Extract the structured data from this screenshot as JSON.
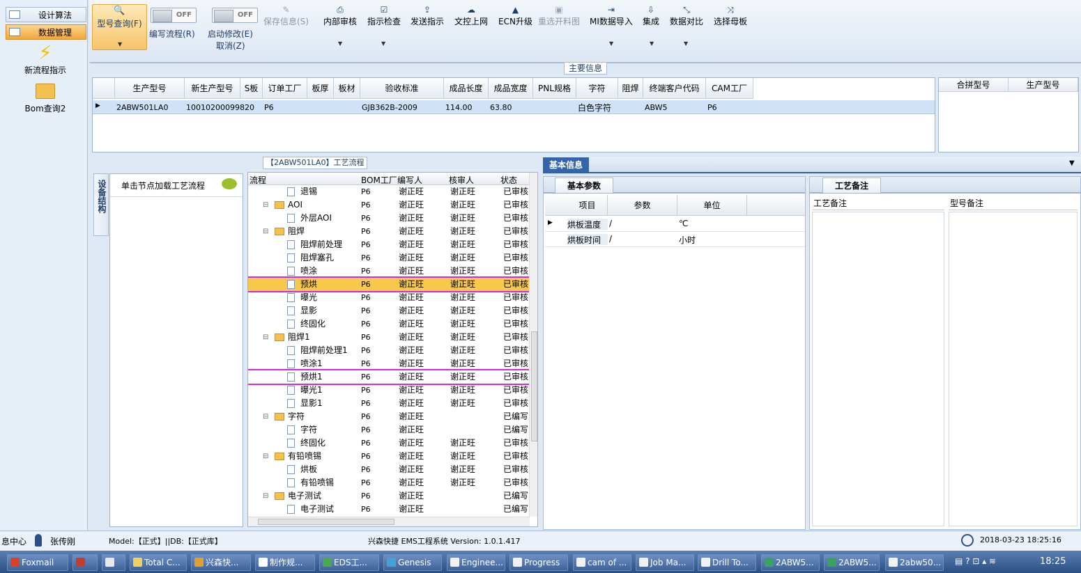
{
  "sidebar": {
    "items": [
      "设计算法",
      "数据管理"
    ],
    "big": [
      "新流程指示",
      "Bom查询2"
    ]
  },
  "ribbon": {
    "query": "型号查询(F)",
    "write_flow": "编写流程(R)",
    "start_edit": "启动修改(E)",
    "cancel": "取消(Z)",
    "toggle_off": "OFF",
    "buttons": [
      "保存信息(S)",
      "内部审核",
      "指示检查",
      "发送指示",
      "文控上网",
      "ECN升级",
      "重选开料图",
      "MI数据导入",
      "集成",
      "数据对比",
      "选择母板"
    ]
  },
  "main_info": {
    "title": "主要信息",
    "columns": [
      "生产型号",
      "新生产型号",
      "S板",
      "订单工厂",
      "板厚",
      "板材",
      "验收标准",
      "成品长度",
      "成品宽度",
      "PNL规格",
      "字符",
      "阻焊",
      "终端客户代码",
      "CAM工厂"
    ],
    "row": [
      "2ABW501LA0",
      "10010200099820",
      "",
      "P6",
      "",
      "",
      "GJB362B-2009",
      "114.00",
      "63.80",
      "",
      "白色字符",
      "",
      "ABW5",
      "P6"
    ],
    "side_columns": [
      "合拼型号",
      "生产型号"
    ]
  },
  "process": {
    "title": "【2ABW501LA0】工艺流程",
    "side_tab": "设备结构",
    "load_hint": "单击节点加载工艺流程",
    "columns": [
      "流程",
      "BOM工厂",
      "编写人",
      "核审人",
      "状态"
    ],
    "rows": [
      {
        "name": "退锡",
        "type": "file",
        "level": 2,
        "bom": "P6",
        "writer": "谢正旺",
        "checker": "谢正旺",
        "status": "已审核"
      },
      {
        "name": "AOI",
        "type": "folder",
        "level": 1,
        "bom": "P6",
        "writer": "谢正旺",
        "checker": "谢正旺",
        "status": "已审核"
      },
      {
        "name": "外层AOI",
        "type": "file",
        "level": 2,
        "bom": "P6",
        "writer": "谢正旺",
        "checker": "谢正旺",
        "status": "已审核"
      },
      {
        "name": "阻焊",
        "type": "folder",
        "level": 1,
        "bom": "P6",
        "writer": "谢正旺",
        "checker": "谢正旺",
        "status": "已审核"
      },
      {
        "name": "阻焊前处理",
        "type": "file",
        "level": 2,
        "bom": "P6",
        "writer": "谢正旺",
        "checker": "谢正旺",
        "status": "已审核"
      },
      {
        "name": "阻焊塞孔",
        "type": "file",
        "level": 2,
        "bom": "P6",
        "writer": "谢正旺",
        "checker": "谢正旺",
        "status": "已审核"
      },
      {
        "name": "喷涂",
        "type": "file",
        "level": 2,
        "bom": "P6",
        "writer": "谢正旺",
        "checker": "谢正旺",
        "status": "已审核"
      },
      {
        "name": "预烘",
        "type": "file",
        "level": 2,
        "bom": "P6",
        "writer": "谢正旺",
        "checker": "谢正旺",
        "status": "已审核",
        "selected": true
      },
      {
        "name": "曝光",
        "type": "file",
        "level": 2,
        "bom": "P6",
        "writer": "谢正旺",
        "checker": "谢正旺",
        "status": "已审核"
      },
      {
        "name": "显影",
        "type": "file",
        "level": 2,
        "bom": "P6",
        "writer": "谢正旺",
        "checker": "谢正旺",
        "status": "已审核"
      },
      {
        "name": "终固化",
        "type": "file",
        "level": 2,
        "bom": "P6",
        "writer": "谢正旺",
        "checker": "谢正旺",
        "status": "已审核"
      },
      {
        "name": "阻焊1",
        "type": "folder",
        "level": 1,
        "bom": "P6",
        "writer": "谢正旺",
        "checker": "谢正旺",
        "status": "已审核"
      },
      {
        "name": "阻焊前处理1",
        "type": "file",
        "level": 2,
        "bom": "P6",
        "writer": "谢正旺",
        "checker": "谢正旺",
        "status": "已审核"
      },
      {
        "name": "喷涂1",
        "type": "file",
        "level": 2,
        "bom": "P6",
        "writer": "谢正旺",
        "checker": "谢正旺",
        "status": "已审核"
      },
      {
        "name": "预烘1",
        "type": "file",
        "level": 2,
        "bom": "P6",
        "writer": "谢正旺",
        "checker": "谢正旺",
        "status": "已审核",
        "outlined": true
      },
      {
        "name": "曝光1",
        "type": "file",
        "level": 2,
        "bom": "P6",
        "writer": "谢正旺",
        "checker": "谢正旺",
        "status": "已审核"
      },
      {
        "name": "显影1",
        "type": "file",
        "level": 2,
        "bom": "P6",
        "writer": "谢正旺",
        "checker": "谢正旺",
        "status": "已审核"
      },
      {
        "name": "字符",
        "type": "folder",
        "level": 1,
        "bom": "P6",
        "writer": "谢正旺",
        "checker": "",
        "status": "已编写"
      },
      {
        "name": "字符",
        "type": "file",
        "level": 2,
        "bom": "P6",
        "writer": "谢正旺",
        "checker": "",
        "status": "已编写"
      },
      {
        "name": "终固化",
        "type": "file",
        "level": 2,
        "bom": "P6",
        "writer": "谢正旺",
        "checker": "谢正旺",
        "status": "已审核"
      },
      {
        "name": "有铅喷锡",
        "type": "folder",
        "level": 1,
        "bom": "P6",
        "writer": "谢正旺",
        "checker": "谢正旺",
        "status": "已审核"
      },
      {
        "name": "烘板",
        "type": "file",
        "level": 2,
        "bom": "P6",
        "writer": "谢正旺",
        "checker": "谢正旺",
        "status": "已审核"
      },
      {
        "name": "有铅喷锡",
        "type": "file",
        "level": 2,
        "bom": "P6",
        "writer": "谢正旺",
        "checker": "谢正旺",
        "status": "已审核"
      },
      {
        "name": "电子测试",
        "type": "folder",
        "level": 1,
        "bom": "P6",
        "writer": "谢正旺",
        "checker": "",
        "status": "已编写"
      },
      {
        "name": "电子测试",
        "type": "file",
        "level": 2,
        "bom": "P6",
        "writer": "谢正旺",
        "checker": "",
        "status": "已编写"
      }
    ]
  },
  "basic": {
    "tab": "基本信息",
    "subtab": "基本参数",
    "columns": [
      "项目",
      "参数",
      "单位"
    ],
    "rows": [
      {
        "item": "烘板温度",
        "param": "/",
        "unit": "℃"
      },
      {
        "item": "烘板时间",
        "param": "/",
        "unit": "小时"
      }
    ]
  },
  "notes": {
    "tab": "工艺备注",
    "col1": "工艺备注",
    "col2": "型号备注"
  },
  "status": {
    "left": "息中心",
    "user": "张传刚",
    "model": "Model:【正式】||DB:【正式库】",
    "app": "兴森快捷 EMS工程系统 Version: 1.0.1.417",
    "datetime": "2018-03-23 18:25:16"
  },
  "taskbar": {
    "items": [
      {
        "label": "Foxmail",
        "color": "#d9412b"
      },
      {
        "label": "",
        "color": "#c43b2f"
      },
      {
        "label": "",
        "color": "#e8e8e8"
      },
      {
        "label": "Total C...",
        "color": "#f0d060"
      },
      {
        "label": "兴森快...",
        "color": "#e0a030"
      },
      {
        "label": "制作规...",
        "color": "#ffffff"
      },
      {
        "label": "EDS工...",
        "color": "#4aa852"
      },
      {
        "label": "Genesis",
        "color": "#46a0d8"
      },
      {
        "label": "Enginee...",
        "color": "#f2f2f2"
      },
      {
        "label": "Progress",
        "color": "#f2f2f2"
      },
      {
        "label": "cam of ...",
        "color": "#f2f2f2"
      },
      {
        "label": "Job Ma...",
        "color": "#f2f2f2"
      },
      {
        "label": "Drill To...",
        "color": "#f2f2f2"
      },
      {
        "label": "2ABW5...",
        "color": "#3aa360"
      },
      {
        "label": "2ABW5...",
        "color": "#3aa360"
      },
      {
        "label": "2abw50...",
        "color": "#f2f2f2"
      }
    ],
    "clock": "18:25"
  }
}
